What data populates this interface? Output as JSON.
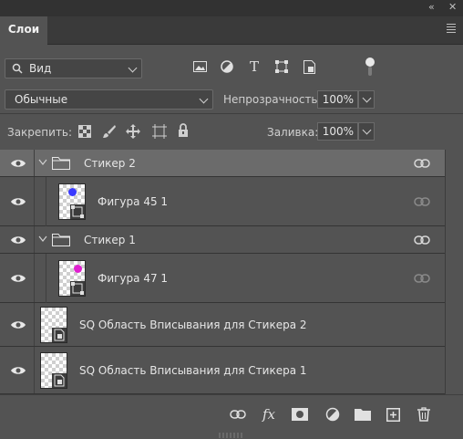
{
  "window": {
    "collapse_icon": "double-chevron-left-icon",
    "close_label": "✕"
  },
  "panel": {
    "tab_label": "Слои",
    "menu_icon": "panel-menu-icon"
  },
  "filter": {
    "kind_label": "Вид",
    "search_icon": "search-icon"
  },
  "filter_icons": [
    "image-filter-icon",
    "adjustment-filter-icon",
    "type-filter-icon",
    "shape-filter-icon",
    "smart-object-filter-icon"
  ],
  "blend": {
    "mode": "Обычные",
    "opacity_label": "Непрозрачность:",
    "opacity_value": "100%"
  },
  "lock": {
    "label": "Закрепить:",
    "fill_label": "Заливка:",
    "fill_value": "100%"
  },
  "layers": [
    {
      "name": "Стикер 2",
      "kind": "group",
      "selected": true
    },
    {
      "name": "Фигура 45 1",
      "kind": "shape",
      "thumb_color": "#3a3aff"
    },
    {
      "name": "Стикер 1",
      "kind": "group",
      "selected": false
    },
    {
      "name": "Фигура 47 1",
      "kind": "shape",
      "thumb_color": "#e020d0"
    },
    {
      "name": "SQ Область Вписывания для Стикера 2",
      "kind": "smart"
    },
    {
      "name": "SQ Область Вписывания для Стикера 1",
      "kind": "smart"
    }
  ],
  "bottom_icons": [
    "link-layers-icon",
    "fx-icon",
    "layer-mask-icon",
    "adjustment-layer-icon",
    "new-group-icon",
    "new-layer-icon",
    "delete-layer-icon"
  ],
  "fx_label": "fx"
}
